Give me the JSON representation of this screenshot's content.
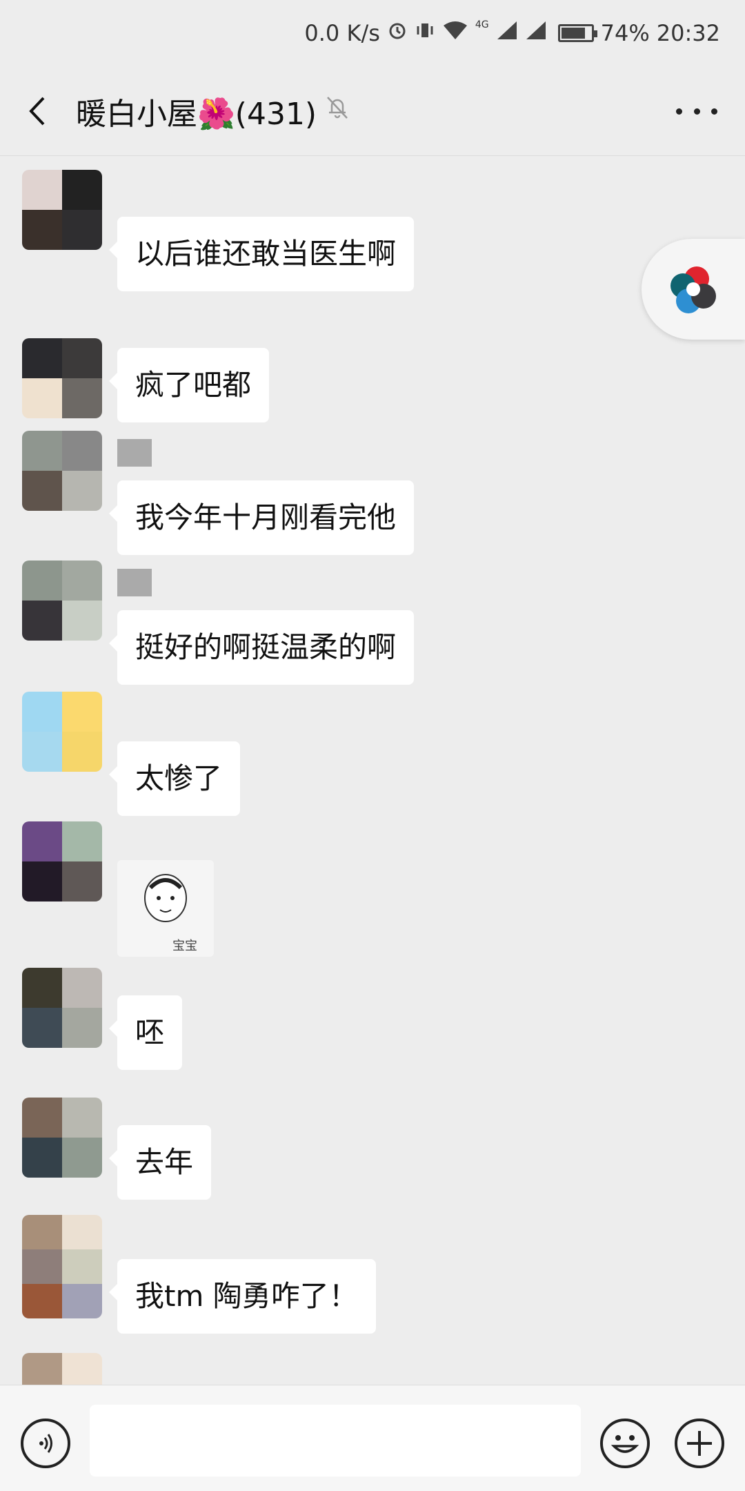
{
  "status_bar": {
    "net_speed": "0.0 K/s",
    "network_type": "4G",
    "battery": "74%",
    "battery_level": 0.74,
    "time": "20:32"
  },
  "header": {
    "title": "暖白小屋🌺(431)",
    "mute_icon": "bell-off-icon",
    "back_icon": "chevron-left-icon",
    "more_icon": "more-horizontal-icon"
  },
  "messages": [
    {
      "text": "以后谁还敢当医生啊"
    },
    {
      "text": "疯了吧都"
    },
    {
      "text": "我今年十月刚看完他"
    },
    {
      "text": "挺好的啊挺温柔的啊"
    },
    {
      "text": "太惨了"
    },
    {
      "sticker_caption": "宝宝"
    },
    {
      "text": "呸"
    },
    {
      "text": "去年"
    },
    {
      "text": "我tm 陶勇咋了！"
    }
  ],
  "input_bar": {
    "voice_icon": "voice-icon",
    "emoji_icon": "emoji-icon",
    "plus_icon": "plus-icon",
    "placeholder": ""
  },
  "colors": {
    "background": "#ededed",
    "bubble": "#ffffff",
    "text": "#111111"
  }
}
